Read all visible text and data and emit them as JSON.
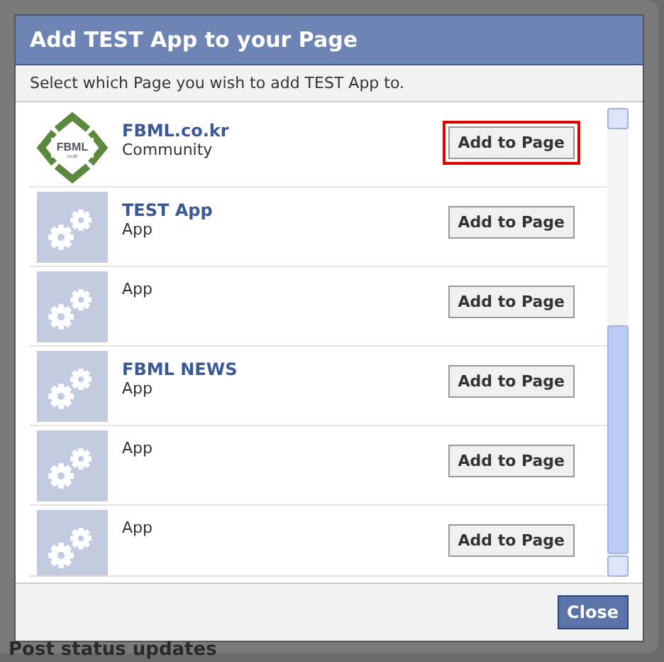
{
  "dialog": {
    "title": "Add TEST App to your Page",
    "prompt": "Select which Page you wish to add TEST App to.",
    "pages": [
      {
        "name": "FBML.co.kr",
        "category": "Community",
        "kind": "logo",
        "logo_text": "FBML",
        "logo_subtext": "co.kr",
        "button": "Add to Page",
        "highlighted": true
      },
      {
        "name": "TEST App",
        "category": "App",
        "kind": "app",
        "button": "Add to Page",
        "highlighted": false
      },
      {
        "category": "App",
        "kind": "app",
        "button": "Add to Page",
        "highlighted": false
      },
      {
        "name": "FBML NEWS",
        "category": "App",
        "kind": "app",
        "button": "Add to Page",
        "highlighted": false
      },
      {
        "category": "App",
        "kind": "app",
        "button": "Add to Page",
        "highlighted": false
      },
      {
        "category": "App",
        "kind": "app",
        "button": "Add to Page",
        "highlighted": false
      }
    ],
    "close_button": "Close"
  },
  "background": {
    "heading": "Post status updates"
  }
}
